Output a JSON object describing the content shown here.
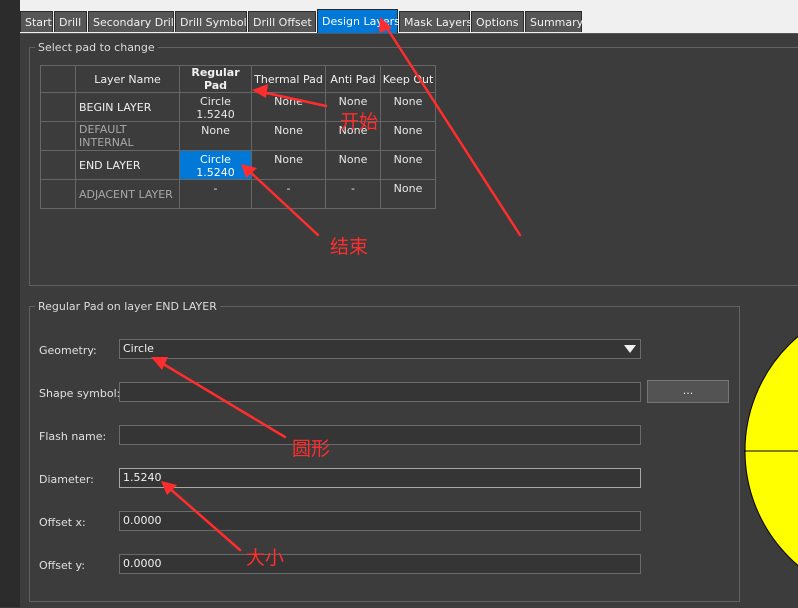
{
  "tabs": [
    {
      "label": "Start",
      "active": false
    },
    {
      "label": "Drill",
      "active": false
    },
    {
      "label": "Secondary Drill",
      "active": false
    },
    {
      "label": "Drill Symbol",
      "active": false
    },
    {
      "label": "Drill Offset",
      "active": false
    },
    {
      "label": "Design Layers",
      "active": true
    },
    {
      "label": "Mask Layers",
      "active": false
    },
    {
      "label": "Options",
      "active": false
    },
    {
      "label": "Summary",
      "active": false
    }
  ],
  "select_group": {
    "legend": "Select pad to change",
    "columns": [
      "Layer Name",
      "Regular Pad",
      "Thermal Pad",
      "Anti Pad",
      "Keep Out"
    ],
    "rows": [
      {
        "name": "BEGIN LAYER",
        "regular": "Circle 1.5240",
        "thermal": "None",
        "anti": "None",
        "keepout": "None"
      },
      {
        "name": "DEFAULT INTERNAL",
        "regular": "None",
        "thermal": "None",
        "anti": "None",
        "keepout": "None"
      },
      {
        "name": "END LAYER",
        "regular": "Circle 1.5240",
        "thermal": "None",
        "anti": "None",
        "keepout": "None"
      },
      {
        "name": "ADJACENT LAYER",
        "regular": "-",
        "thermal": "-",
        "anti": "-",
        "keepout": "None"
      }
    ]
  },
  "pad_group": {
    "legend": "Regular Pad on layer END LAYER",
    "geometry_label": "Geometry:",
    "geometry_value": "Circle",
    "shape_symbol_label": "Shape symbol:",
    "shape_symbol_value": "",
    "browse_label": "...",
    "flash_name_label": "Flash name:",
    "flash_name_value": "",
    "diameter_label": "Diameter:",
    "diameter_value": "1.5240",
    "offset_x_label": "Offset x:",
    "offset_x_value": "0.0000",
    "offset_y_label": "Offset y:",
    "offset_y_value": "0.0000"
  },
  "annotations": {
    "start": "开始",
    "end": "结束",
    "circle": "圆形",
    "size": "大小"
  },
  "colors": {
    "accent": "#0078d7",
    "preview_fill": "#ffff00",
    "annotation": "#ff2d2d"
  }
}
